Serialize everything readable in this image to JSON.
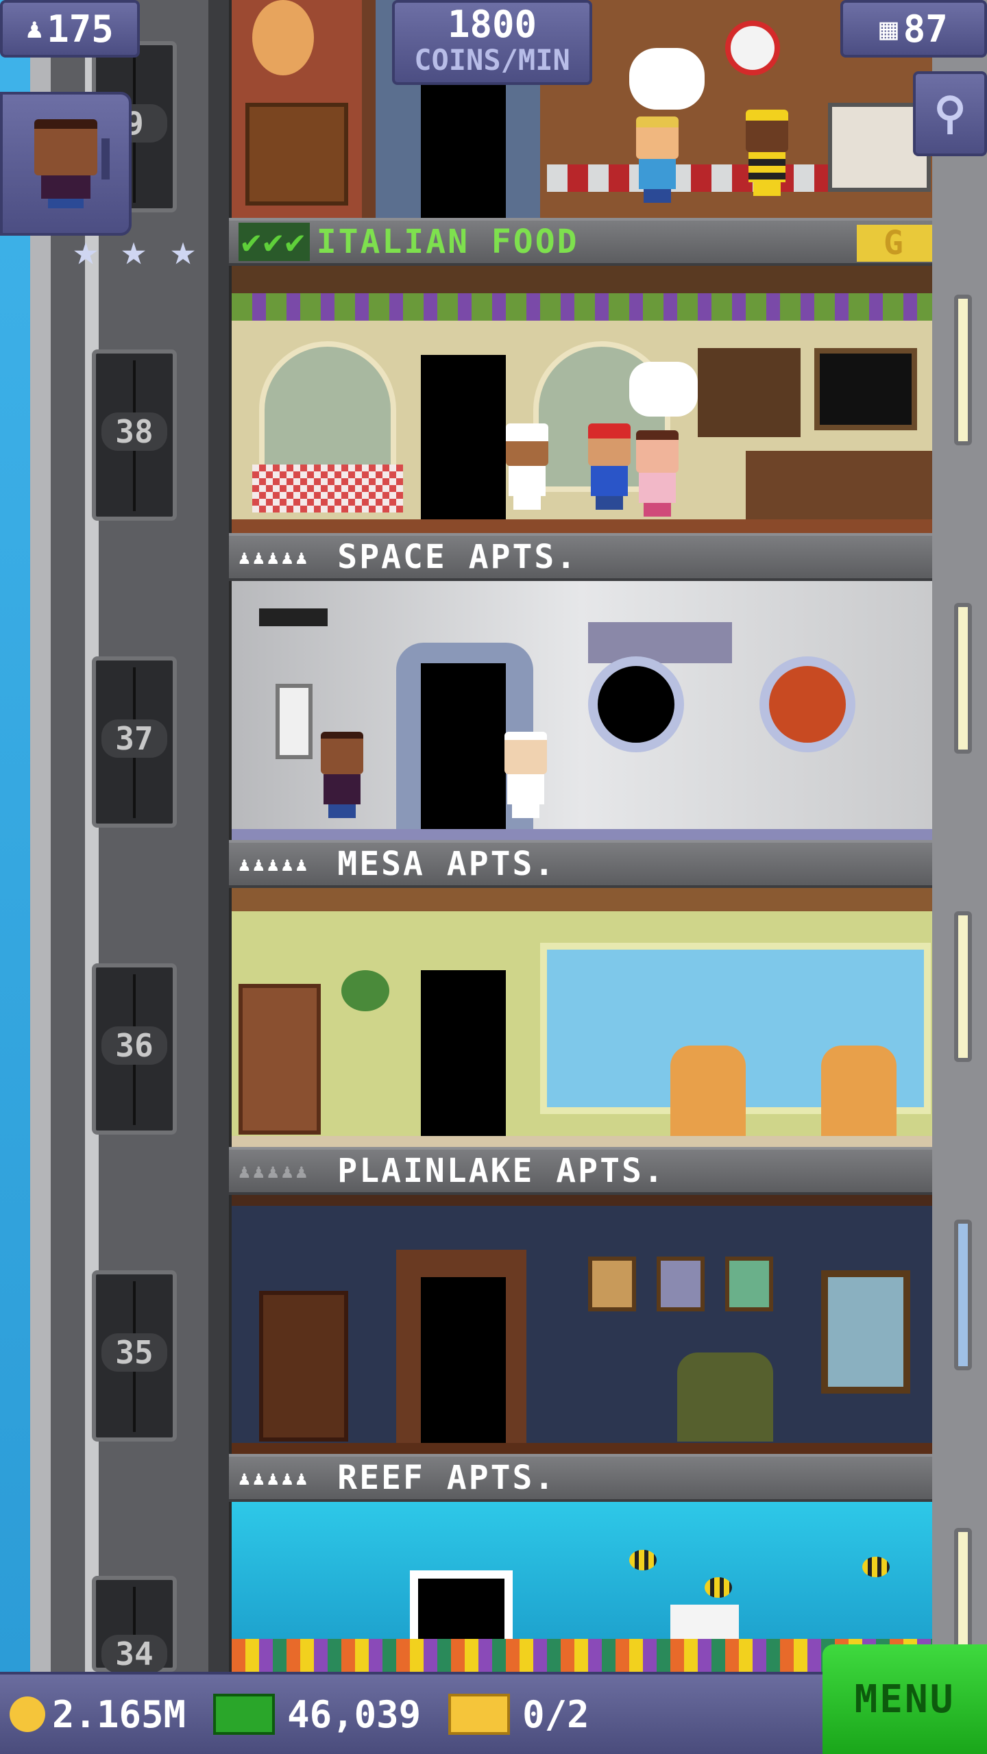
{
  "hud": {
    "population": "175",
    "coins_per_min": "1800",
    "coins_per_min_unit": "COINS/MIN",
    "floors": "87",
    "top_floor_number": "9"
  },
  "floors": [
    {
      "name": "ITALIAN FOOD",
      "elevator_number": "38",
      "checks": "✔✔✔",
      "badge": "G"
    },
    {
      "name": "SPACE APTS.",
      "elevator_number": "37",
      "pips": "♟♟♟♟♟"
    },
    {
      "name": "MESA APTS.",
      "elevator_number": "36",
      "pips": "♟♟♟♟♟"
    },
    {
      "name": "PLAINLAKE APTS.",
      "elevator_number": "35",
      "pips": "♟♟♟♟♟"
    },
    {
      "name": "REEF APTS.",
      "elevator_number": "34",
      "pips": "♟♟♟♟♟"
    }
  ],
  "bottom": {
    "coins": "2.165M",
    "bux": "46,039",
    "tickets": "0/2",
    "menu_label": "MENU"
  },
  "colors": {
    "hud_bg": "#5a5c91",
    "menu_green": "#2ec62e",
    "label_green": "#7ee04e",
    "coin_gold": "#f5c53a"
  }
}
